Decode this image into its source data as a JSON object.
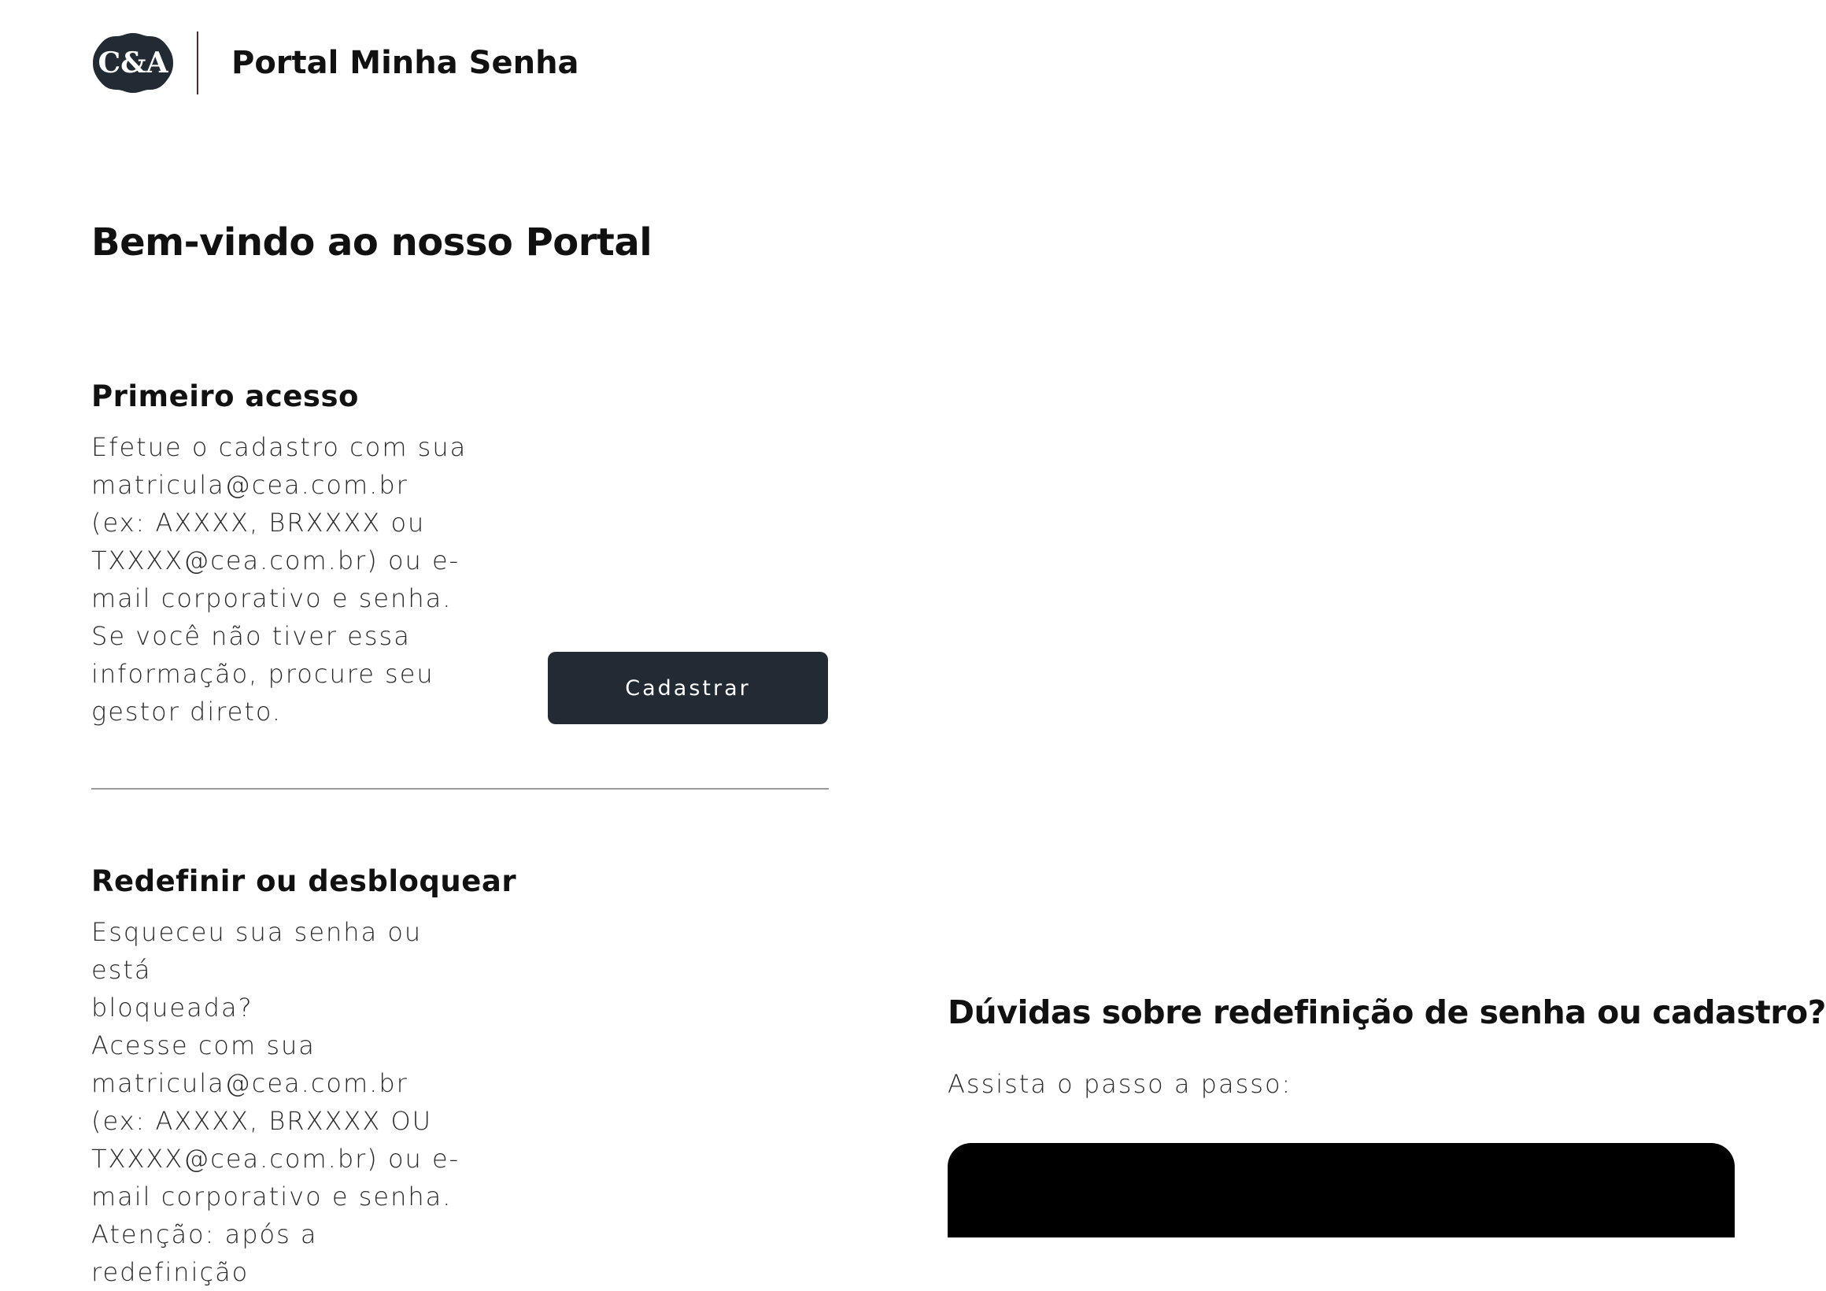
{
  "header": {
    "logo_text": "C&A",
    "portal_name": "Portal Minha Senha"
  },
  "welcome": "Bem-vindo ao nosso Portal",
  "first_access": {
    "title": "Primeiro acesso",
    "lines": [
      "Efetue o cadastro com sua",
      "matricula@cea.com.br",
      "(ex: AXXXX, BRXXXX ou",
      "TXXXX@cea.com.br) ou e-",
      "mail corporativo e senha.",
      "Se você não tiver essa",
      "informação, procure seu",
      "gestor direto."
    ],
    "button_label": "Cadastrar"
  },
  "reset": {
    "title": "Redefinir ou desbloquear",
    "lines": [
      "Esqueceu sua senha ou está",
      "bloqueada?",
      "Acesse com sua",
      "matricula@cea.com.br",
      "(ex: AXXXX, BRXXXX OU",
      "TXXXX@cea.com.br) ou e-",
      "mail corporativo e senha.",
      "Atenção: após a redefinição"
    ]
  },
  "help": {
    "title": "Dúvidas sobre redefinição de senha ou cadastro?",
    "subtitle": "Assista o passo a passo:"
  },
  "colors": {
    "button_bg": "#222a33",
    "logo_bg": "#222a33",
    "divider": "#9a9a9a",
    "header_divider": "#4a2c2c"
  }
}
